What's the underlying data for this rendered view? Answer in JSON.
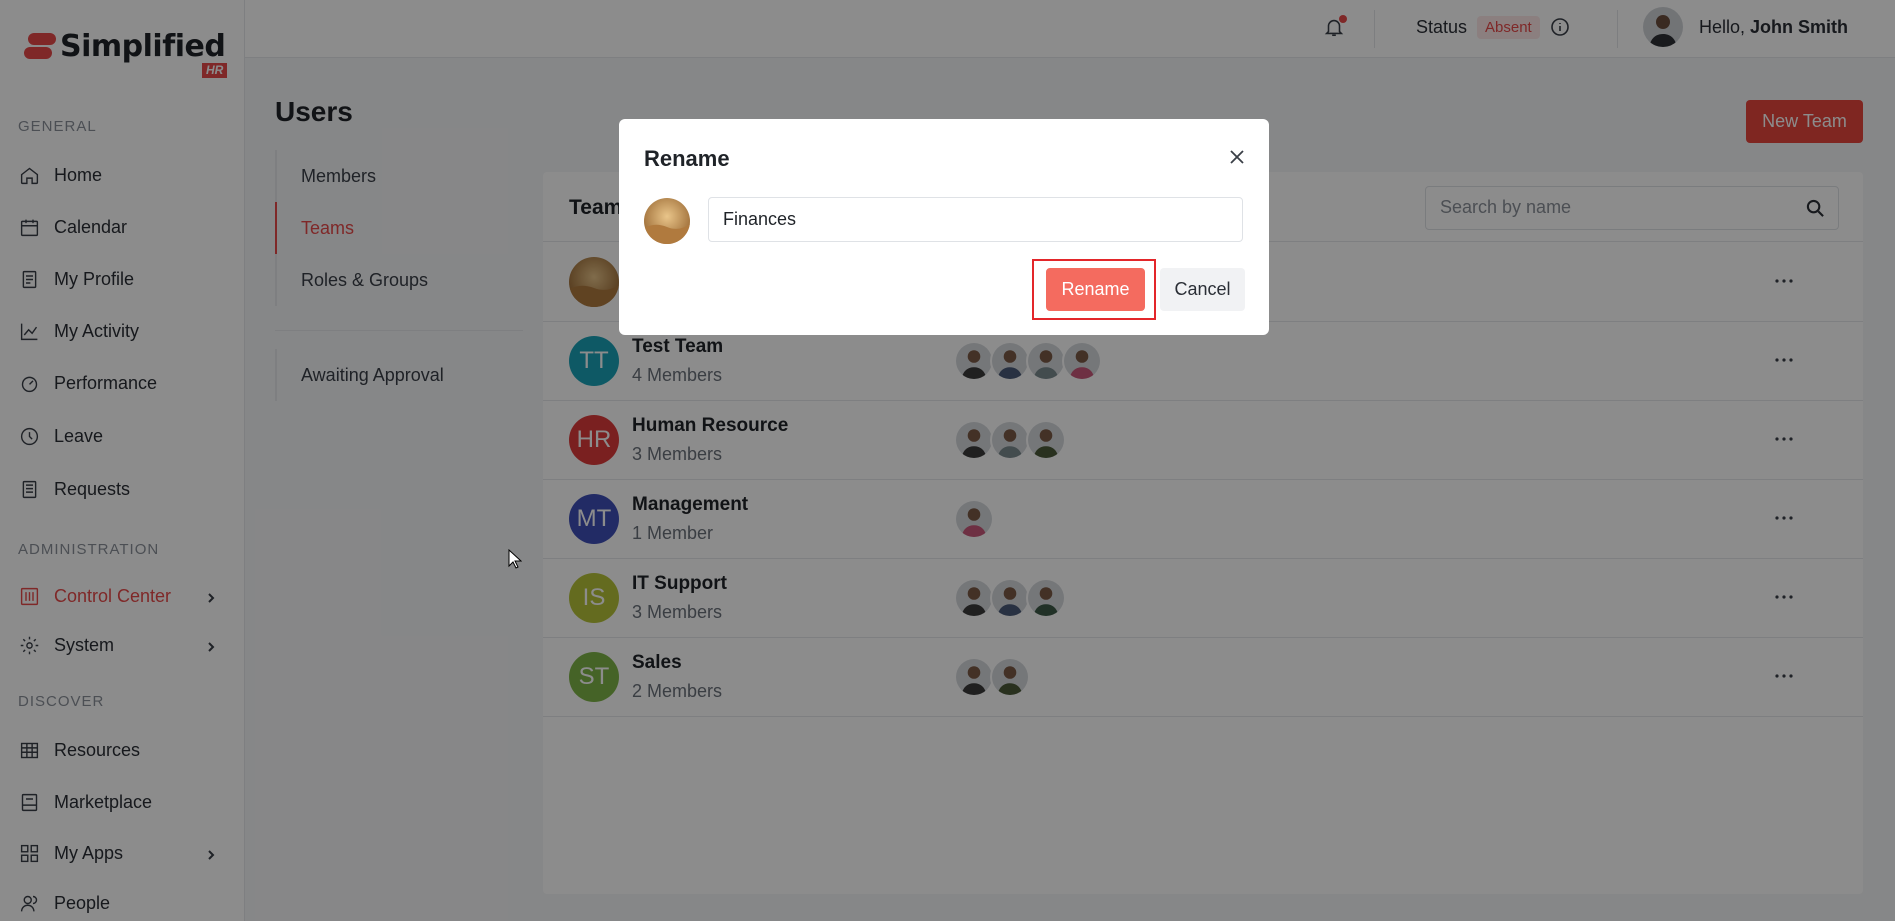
{
  "brand": {
    "name": "Simplified",
    "badge": "HR",
    "color": "#e74a4a"
  },
  "sidebar": {
    "sections": [
      {
        "label": "GENERAL"
      },
      {
        "label": "ADMINISTRATION"
      },
      {
        "label": "DISCOVER"
      }
    ],
    "items": [
      {
        "label": "Home",
        "icon": "home-icon"
      },
      {
        "label": "Calendar",
        "icon": "calendar-icon"
      },
      {
        "label": "My Profile",
        "icon": "profile-icon"
      },
      {
        "label": "My Activity",
        "icon": "activity-icon"
      },
      {
        "label": "Performance",
        "icon": "gauge-icon"
      },
      {
        "label": "Leave",
        "icon": "clock-icon"
      },
      {
        "label": "Requests",
        "icon": "requests-icon"
      },
      {
        "label": "Control Center",
        "icon": "control-center-icon",
        "active": true
      },
      {
        "label": "System",
        "icon": "gear-icon"
      },
      {
        "label": "Resources",
        "icon": "grid-table-icon"
      },
      {
        "label": "Marketplace",
        "icon": "marketplace-icon"
      },
      {
        "label": "My Apps",
        "icon": "apps-icon"
      },
      {
        "label": "People",
        "icon": "people-icon"
      }
    ]
  },
  "header": {
    "status_label": "Status",
    "status_value": "Absent",
    "greeting": "Hello,",
    "user_name": "John Smith"
  },
  "page": {
    "title": "Users",
    "new_team_label": "New Team",
    "subnav": [
      {
        "label": "Members"
      },
      {
        "label": "Teams",
        "active": true
      },
      {
        "label": "Roles & Groups"
      },
      {
        "label": "Awaiting Approval"
      }
    ],
    "panel_title": "Teams",
    "search_placeholder": "Search by name"
  },
  "teams": [
    {
      "initials": "",
      "name": "",
      "count": "",
      "color": "#c89a5a",
      "members": []
    },
    {
      "initials": "TT",
      "name": "Test Team",
      "count": "4 Members",
      "color": "#1aa3b8",
      "members": [
        "#3b3b3b",
        "#4a5a78",
        "#7a8a8f",
        "#c9587a"
      ]
    },
    {
      "initials": "HR",
      "name": "Human Resource",
      "count": "3 Members",
      "color": "#de3b3b",
      "members": [
        "#3b3b3b",
        "#7a8a8f",
        "#4b5a3a"
      ]
    },
    {
      "initials": "MT",
      "name": "Management",
      "count": "1 Member",
      "color": "#3f4fb8",
      "members": [
        "#c9587a"
      ]
    },
    {
      "initials": "IS",
      "name": "IT Support",
      "count": "3 Members",
      "color": "#b7c43a",
      "members": [
        "#3b3b3b",
        "#4a5a78",
        "#3d5a48"
      ]
    },
    {
      "initials": "ST",
      "name": "Sales",
      "count": "2 Members",
      "color": "#7fb547",
      "members": [
        "#3b3b3b",
        "#4b5a3a"
      ]
    }
  ],
  "modal": {
    "title": "Rename",
    "input_value": "Finances",
    "rename_label": "Rename",
    "cancel_label": "Cancel"
  }
}
